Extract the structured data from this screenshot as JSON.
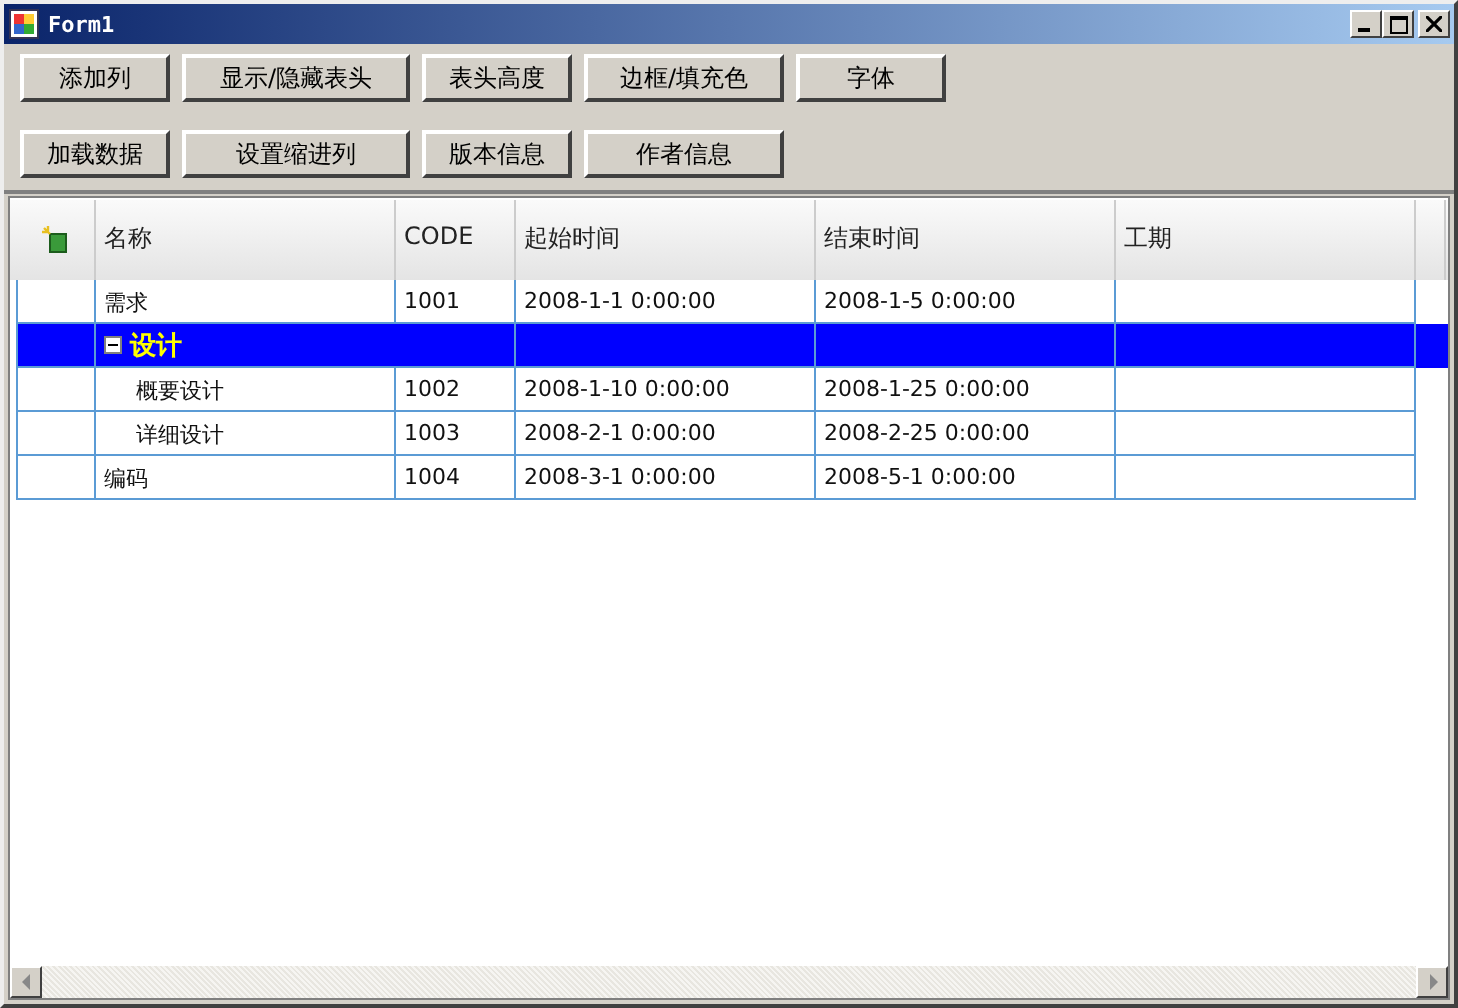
{
  "window": {
    "title": "Form1"
  },
  "toolbar": [
    [
      "添加列",
      "显示/隐藏表头",
      "表头高度",
      "边框/填充色",
      "字体"
    ],
    [
      "加载数据",
      "设置缩进列",
      "版本信息",
      "作者信息"
    ]
  ],
  "grid": {
    "columns": [
      "名称",
      "CODE",
      "起始时间",
      "结束时间",
      "工期"
    ],
    "rows": [
      {
        "name": "需求",
        "code": "1001",
        "start": "2008-1-1 0:00:00",
        "end": "2008-1-5 0:00:00",
        "selected": false
      },
      {
        "name": "设计",
        "selected": true,
        "expanded": true,
        "children": [
          {
            "name": "概要设计",
            "code": "1002",
            "start": "2008-1-10 0:00:00",
            "end": "2008-1-25 0:00:00",
            "selected": false
          },
          {
            "name": "详细设计",
            "code": "1003",
            "start": "2008-2-1 0:00:00",
            "end": "2008-2-25 0:00:00",
            "selected": false
          }
        ]
      },
      {
        "name": "编码",
        "code": "1004",
        "start": "2008-3-1 0:00:00",
        "end": "2008-5-1 0:00:00",
        "selected": false
      }
    ]
  }
}
